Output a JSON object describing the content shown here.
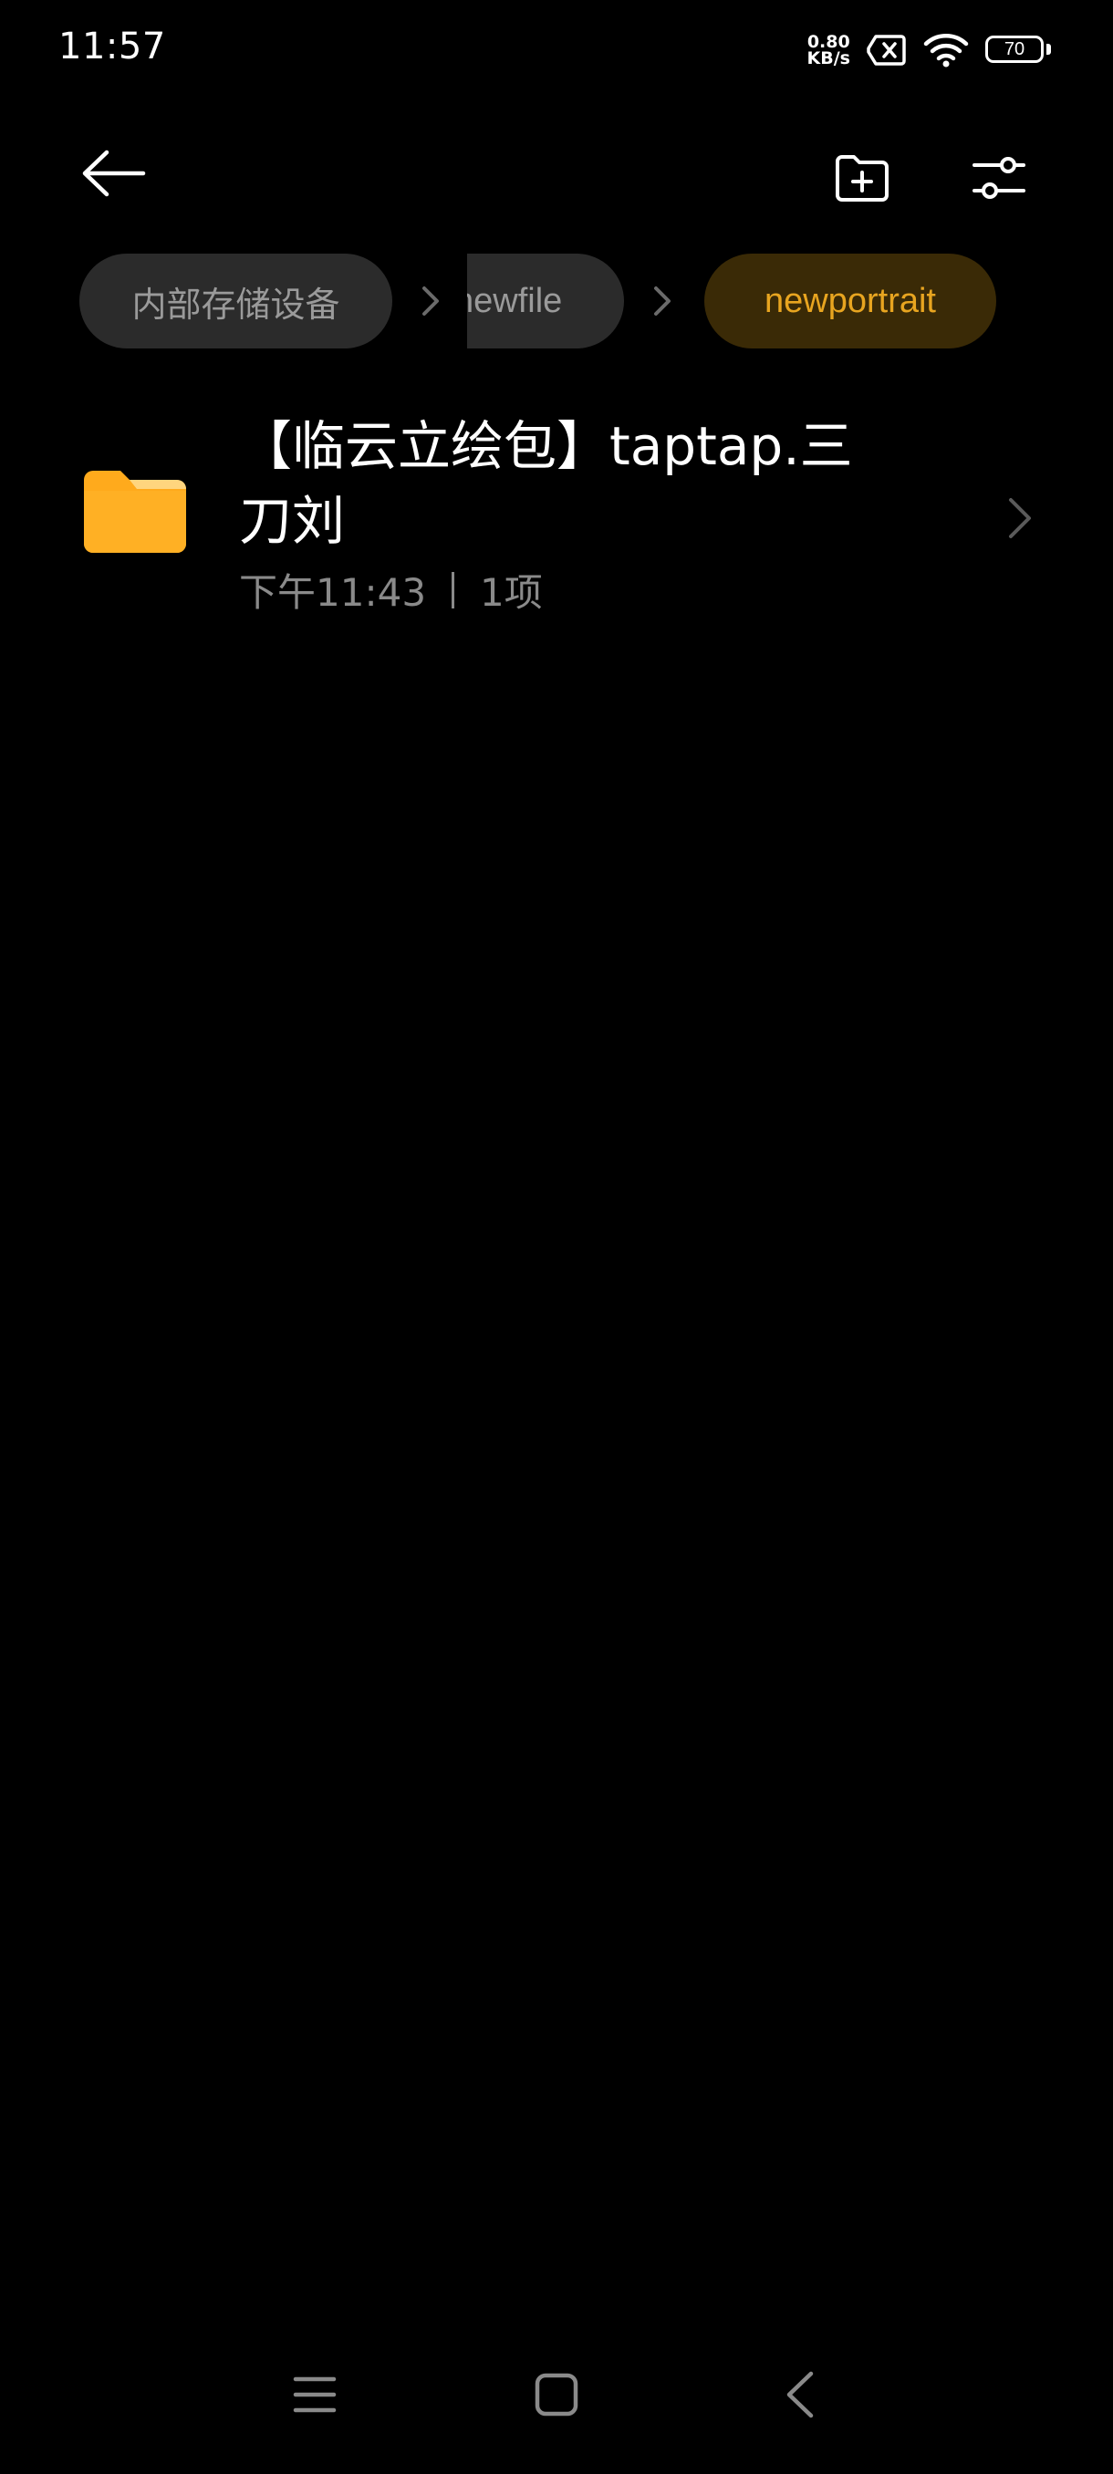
{
  "status_bar": {
    "time": "11:57",
    "net_speed_value": "0.80",
    "net_speed_unit": "KB/s",
    "battery_level": "70",
    "icons": [
      "sim-off-icon",
      "wifi-icon",
      "battery-icon"
    ]
  },
  "toolbar": {
    "icons": [
      "back-arrow-icon",
      "new-folder-icon",
      "sliders-icon"
    ]
  },
  "breadcrumb": {
    "items": [
      {
        "label": "内部存储设备"
      },
      {
        "label": "newfile"
      },
      {
        "label": "newportrait"
      }
    ],
    "separator_icon": "chevron-right-icon",
    "active_color": "#e8a520"
  },
  "files": [
    {
      "name": "【临云立绘包】taptap.三刀刘",
      "time": "下午11:43",
      "count": "1项",
      "icon": "folder-icon",
      "icon_color": "#ffaa1c"
    }
  ],
  "nav_bar": {
    "icons": [
      "menu-icon",
      "home-square-icon",
      "back-triangle-icon"
    ]
  }
}
